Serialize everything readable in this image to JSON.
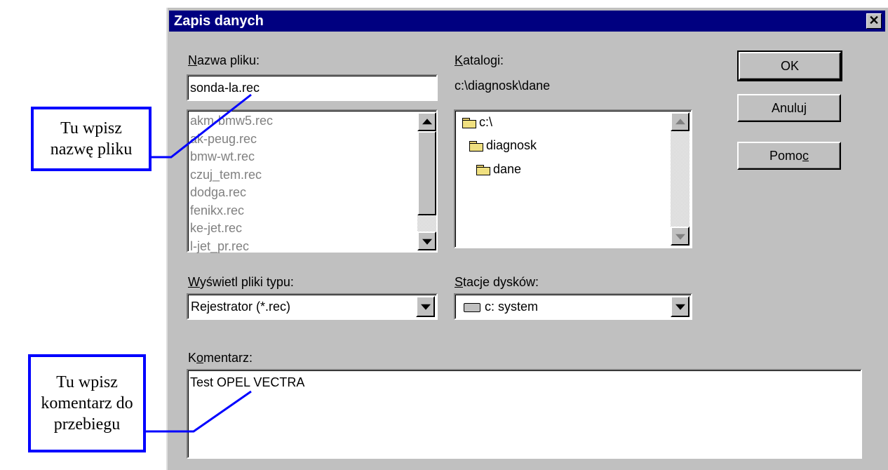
{
  "dialog": {
    "title": "Zapis danych",
    "close_glyph": "✕"
  },
  "filename": {
    "label_u": "N",
    "label_rest": "azwa pliku:",
    "value": "sonda-la.rec"
  },
  "file_list": [
    "akm-bmw5.rec",
    "ak-peug.rec",
    "bmw-wt.rec",
    "czuj_tem.rec",
    "dodga.rec",
    "fenikx.rec",
    "ke-jet.rec",
    "l-jet_pr.rec"
  ],
  "directories": {
    "label_u": "K",
    "label_rest": "atalogi:",
    "path": "c:\\diagnosk\\dane",
    "items": [
      "c:\\",
      "diagnosk",
      "dane"
    ]
  },
  "filetype": {
    "label_u": "W",
    "label_rest": "yświetl pliki typu:",
    "value": "Rejestrator (*.rec)"
  },
  "drives": {
    "label_u": "S",
    "label_rest": "tacje dysków:",
    "value": "c: system"
  },
  "buttons": {
    "ok": "OK",
    "cancel": "Anuluj",
    "help_pre": "Pomo",
    "help_u": "c"
  },
  "comment": {
    "label_pre": "K",
    "label_u": "o",
    "label_rest": "mentarz:",
    "value": "Test OPEL VECTRA"
  },
  "annotations": {
    "filename_hint": [
      "Tu wpisz",
      "nazwę pliku"
    ],
    "comment_hint": [
      "Tu wpisz",
      "komentarz do",
      "przebiegu"
    ]
  },
  "colors": {
    "title_bar": "#000080",
    "annotation_border": "#0000ff",
    "dialog_bg": "#c0c0c0"
  }
}
